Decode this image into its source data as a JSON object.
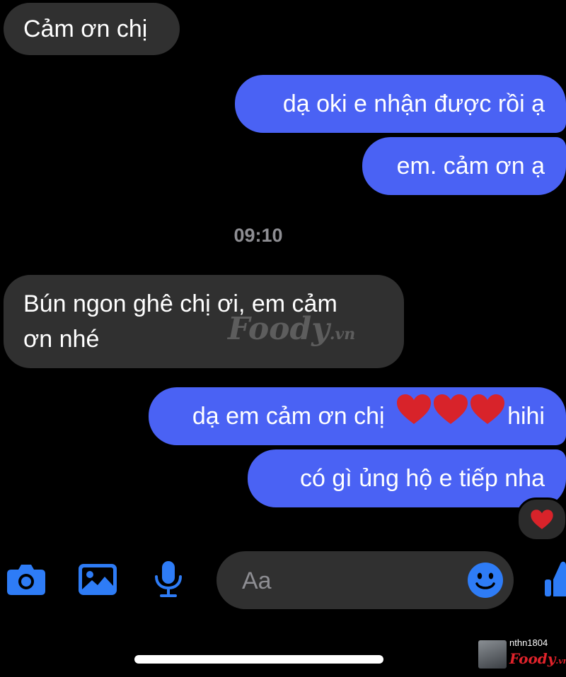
{
  "messages": [
    {
      "from": "them",
      "text": "Cảm ơn chị"
    },
    {
      "from": "me",
      "text": "dạ oki e nhận được rồi ạ"
    },
    {
      "from": "me",
      "text": "em. cảm ơn ạ"
    },
    {
      "from": "them",
      "text": "Bún ngon ghê chị ơi, em cảm"
    },
    {
      "from": "them",
      "text": "ơn nhé"
    },
    {
      "from": "me",
      "text": "dạ em cảm ơn chị",
      "suffix": "hihi"
    },
    {
      "from": "me",
      "text": "có gì ủng hộ e tiếp nha"
    }
  ],
  "timestamp": "09:10",
  "reaction": {
    "emoji": "heart-icon"
  },
  "watermark": {
    "main": "Foody",
    "tld": ".vn"
  },
  "composer": {
    "placeholder": "Aa"
  },
  "toolbar": {
    "icons": [
      "camera-icon",
      "image-icon",
      "microphone-icon",
      "emoji-icon",
      "like-icon"
    ]
  },
  "credit": {
    "username": "nthn1804",
    "brand": "Foody",
    "tld": ".vn"
  },
  "colors": {
    "background": "#000000",
    "incoming_bubble": "#303030",
    "outgoing_bubble": "#4a62f4",
    "icon_blue": "#2e7cf6",
    "heart": "#d8232a"
  }
}
